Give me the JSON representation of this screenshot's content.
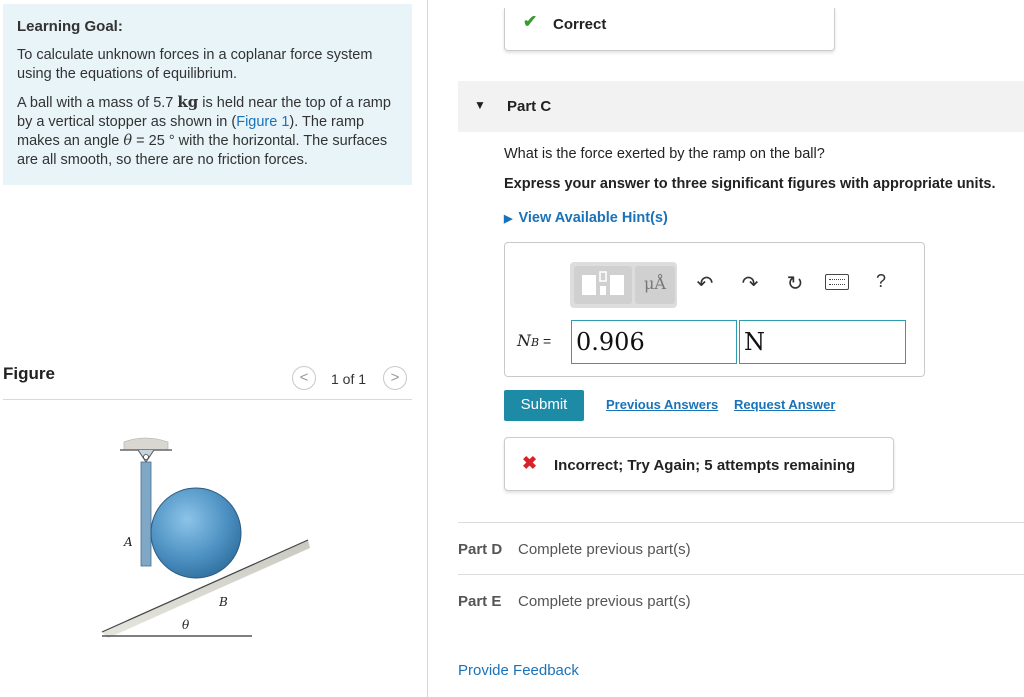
{
  "learning_goal": {
    "heading": "Learning Goal:",
    "goal_text": "To calculate unknown forces in a coplanar force system using the equations of equilibrium.",
    "problem": {
      "part1": "A ball with a mass of 5.7 ",
      "mass_unit": "kg",
      "part2": " is held near the top of a ramp by a vertical stopper as shown in (",
      "figure_link": "Figure 1",
      "part3": "). The ramp makes an angle ",
      "theta": "θ",
      "part4": " = 25 ° with the horizontal. The surfaces are all smooth, so there are no friction forces."
    }
  },
  "figure": {
    "title": "Figure",
    "prev": "<",
    "next": ">",
    "count": "1 of 1",
    "labels": {
      "a": "A",
      "b": "B",
      "theta": "θ"
    }
  },
  "correct_banner": {
    "icon": "check-icon",
    "text": "Correct"
  },
  "part_c": {
    "title": "Part C",
    "question": "What is the force exerted by the ramp on the ball?",
    "instruction": "Express your answer to three significant figures with appropriate units.",
    "hints": "View Available Hint(s)",
    "toolbar": {
      "units": "μÅ",
      "help": "?"
    },
    "variable": "N",
    "subscript": "B",
    "equals": " =",
    "value": "0.906",
    "unit": "N",
    "submit": "Submit",
    "previous_answers": "Previous Answers",
    "request_answer": "Request Answer",
    "feedback": "Incorrect; Try Again; 5 attempts remaining"
  },
  "part_d": {
    "label": "Part D",
    "status": "Complete previous part(s)"
  },
  "part_e": {
    "label": "Part E",
    "status": "Complete previous part(s)"
  },
  "provide_feedback": "Provide Feedback",
  "colors": {
    "accent": "#1d8aa6",
    "link": "#1a73b8",
    "correct": "#3a9a31",
    "incorrect": "#d6232b",
    "goal_bg": "#e8f4f8"
  }
}
